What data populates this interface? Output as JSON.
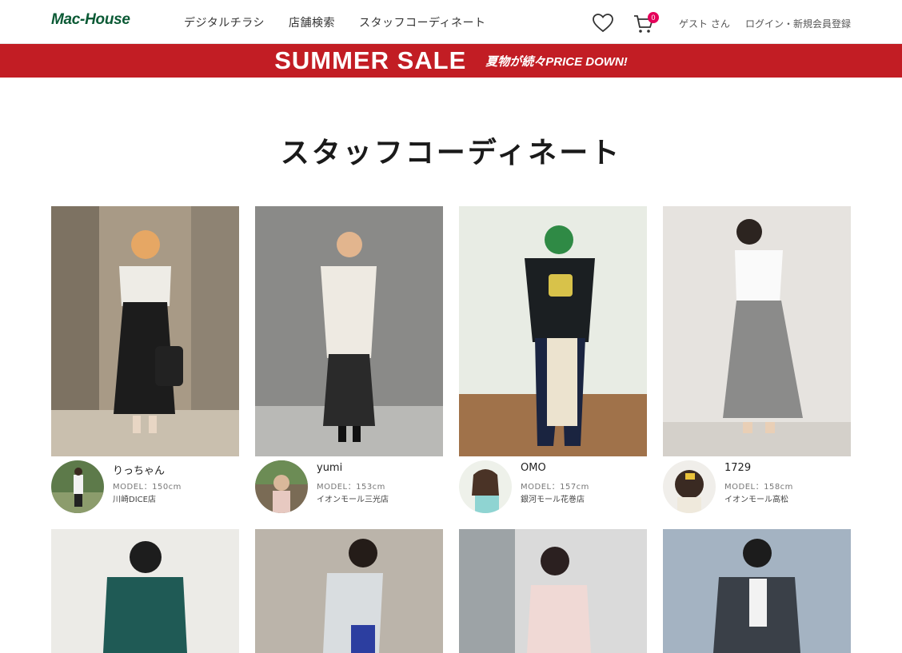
{
  "header": {
    "logo": "Mac-House",
    "nav": [
      "デジタルチラシ",
      "店舗検索",
      "スタッフコーディネート"
    ],
    "cart_count": "0",
    "guest_label": "ゲスト さん",
    "login_label": "ログイン・新規会員登録"
  },
  "banner": {
    "title": "SUMMER SALE",
    "subtitle": "夏物が続々PRICE DOWN!"
  },
  "page": {
    "title": "スタッフコーディネート"
  },
  "staff": [
    {
      "name": "りっちゃん",
      "model": "MODEL：150cm",
      "store": "川崎DICE店"
    },
    {
      "name": "yumi",
      "model": "MODEL：153cm",
      "store": "イオンモール三光店"
    },
    {
      "name": "OMO",
      "model": "MODEL：157cm",
      "store": "銀河モール花巻店"
    },
    {
      "name": "1729",
      "model": "MODEL：158cm",
      "store": "イオンモール高松"
    }
  ],
  "colors": {
    "brand_green": "#0b5a35",
    "sale_red": "#c21d24",
    "badge_pink": "#e5005a"
  },
  "icons": [
    "heart-icon",
    "cart-icon"
  ]
}
